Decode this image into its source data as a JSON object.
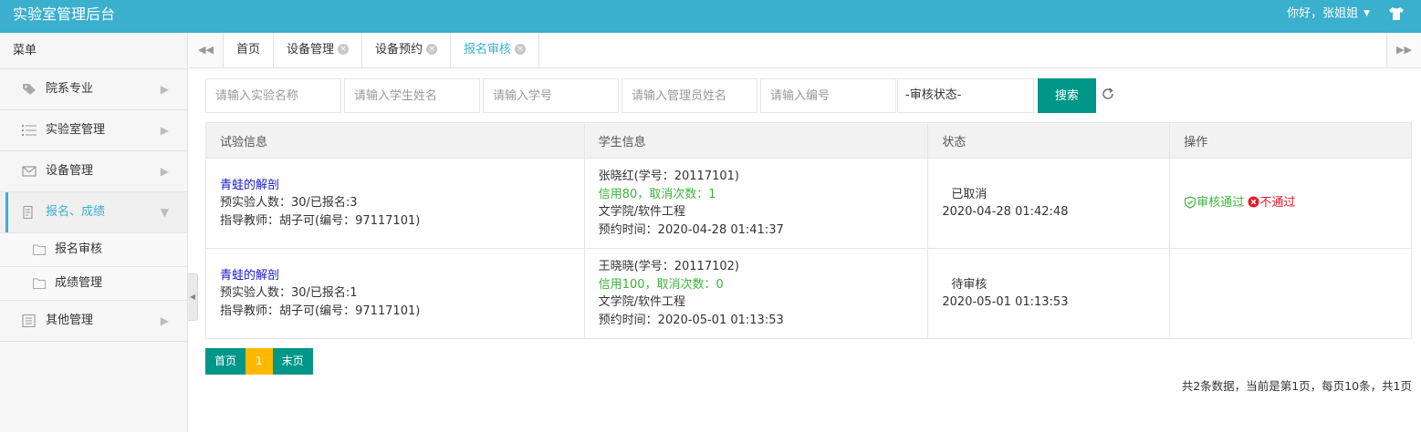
{
  "header": {
    "title": "实验室管理后台",
    "greeting": "你好，张姐姐"
  },
  "sidebar": {
    "title": "菜单",
    "items": [
      {
        "label": "院系专业",
        "icon": "tag-icon"
      },
      {
        "label": "实验室管理",
        "icon": "list-icon"
      },
      {
        "label": "设备管理",
        "icon": "mail-icon"
      },
      {
        "label": "报名、成绩",
        "icon": "form-icon",
        "active": true,
        "children": [
          {
            "label": "报名审核"
          },
          {
            "label": "成绩管理"
          }
        ]
      },
      {
        "label": "其他管理",
        "icon": "document-icon"
      }
    ]
  },
  "tabs": [
    {
      "label": "首页",
      "closable": false
    },
    {
      "label": "设备管理",
      "closable": true
    },
    {
      "label": "设备预约",
      "closable": true
    },
    {
      "label": "报名审核",
      "closable": true,
      "active": true
    }
  ],
  "search": {
    "experiment_placeholder": "请输入实验名称",
    "student_name_placeholder": "请输入学生姓名",
    "student_id_placeholder": "请输入学号",
    "admin_name_placeholder": "请输入管理员姓名",
    "number_placeholder": "请输入编号",
    "status_select": "-审核状态-",
    "search_button": "搜索"
  },
  "table": {
    "headers": [
      "试验信息",
      "学生信息",
      "状态",
      "操作"
    ],
    "rows": [
      {
        "experiment": "青蛙的解剖",
        "quota": "预实验人数：30/已报名:3",
        "teacher": "指导教师：胡子可(编号：97117101)",
        "student": "张晓红(学号：20117101)",
        "credit": "信用80，取消次数：1",
        "major": "文学院/软件工程",
        "booking_time": "预约时间：2020-04-28 01:41:37",
        "status": "已取消",
        "status_time": "2020-04-28 01:42:48",
        "approve": "审核通过",
        "reject": "不通过"
      },
      {
        "experiment": "青蛙的解剖",
        "quota": "预实验人数：30/已报名:1",
        "teacher": "指导教师：胡子可(编号：97117101)",
        "student": "王晓晓(学号：20117102)",
        "credit": "信用100，取消次数：0",
        "major": "文学院/软件工程",
        "booking_time": "预约时间：2020-05-01 01:13:53",
        "status": "待审核",
        "status_time": "2020-05-01 01:13:53",
        "approve": "",
        "reject": ""
      }
    ]
  },
  "pagination": {
    "first": "首页",
    "current": "1",
    "last": "末页",
    "summary": "共2条数据，当前是第1页，每页10条，共1页"
  },
  "colors": {
    "header": "#3aafce",
    "primary": "#009688",
    "current_page": "#ffb800",
    "link": "#1a1ad4",
    "success": "#3cb43c",
    "danger": "#e8192c"
  }
}
